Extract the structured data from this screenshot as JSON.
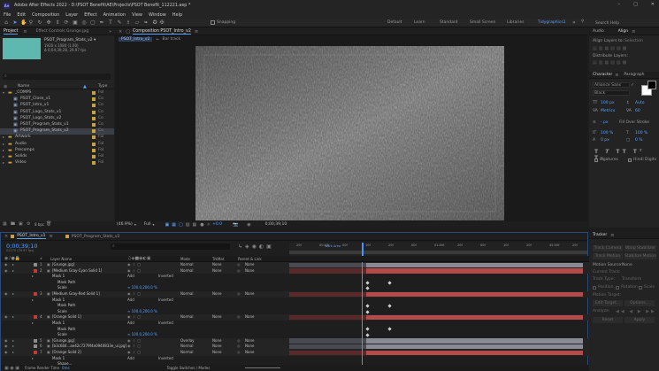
{
  "window": {
    "title": "Adobe After Effects 2022 - D:\\PSOT Benefit\\AE\\Projects\\PSOT Benefit_112221.aep *"
  },
  "menu": [
    "File",
    "Edit",
    "Composition",
    "Layer",
    "Effect",
    "Animation",
    "View",
    "Window",
    "Help"
  ],
  "toolbar": {
    "snapping": "Snapping",
    "workspaces": [
      "Default",
      "Learn",
      "Standard",
      "Small Screen",
      "Libraries",
      "Tidygraphics1"
    ],
    "search_placeholder": "Search Help"
  },
  "project": {
    "tab": "Project",
    "effect_tab": "Effect Controls Grunge.jpg",
    "selected_name": "PSOT_Program_Stats_v2 ▾",
    "selected_info1": "1920 x 1080 (1.00)",
    "selected_info2": "Δ 0;04;39;28, 29.97 fps",
    "search_placeholder": "⌕",
    "col_name": "Name",
    "col_type": "Type",
    "items": [
      {
        "name": "_COMPS",
        "type": "Fol",
        "color": "#c8a23c",
        "indent": 0,
        "open": true
      },
      {
        "name": "PSOT_Close_v1",
        "type": "Co",
        "color": "#c8a23c",
        "indent": 1
      },
      {
        "name": "PSOT_Intro_v1",
        "type": "Co",
        "color": "#c8a23c",
        "indent": 1
      },
      {
        "name": "PSOT_Logo_Stats_v1",
        "type": "Co",
        "color": "#c8a23c",
        "indent": 1
      },
      {
        "name": "PSOT_Logo_Stats_v2",
        "type": "Co",
        "color": "#c8a23c",
        "indent": 1
      },
      {
        "name": "PSOT_Program_Stats_v1",
        "type": "Co",
        "color": "#c8a23c",
        "indent": 1
      },
      {
        "name": "PSOT_Program_Stats_v2",
        "type": "Co",
        "color": "#c8a23c",
        "indent": 1,
        "selected": true
      },
      {
        "name": "Artwork",
        "type": "Fol",
        "color": "#c8a23c",
        "indent": 0
      },
      {
        "name": "Audio",
        "type": "Fol",
        "color": "#c8a23c",
        "indent": 0
      },
      {
        "name": "Precomps",
        "type": "Fol",
        "color": "#c8a23c",
        "indent": 0
      },
      {
        "name": "Solids",
        "type": "Fol",
        "color": "#c8a23c",
        "indent": 0
      },
      {
        "name": "Video",
        "type": "Fol",
        "color": "#c8a23c",
        "indent": 0
      }
    ],
    "bpc": "8 bpc"
  },
  "composition": {
    "tab": "Composition PSOT_Intro_v2",
    "subtab": "PSOT_Intro_v2",
    "flowchart": "Bar track",
    "zoom": "(46.9%)",
    "quality": "Full",
    "exposure": "+0.0",
    "timecode": "0;00;39;10"
  },
  "right": {
    "audio": "Audio",
    "align": "Align",
    "align_to_label": "Align Layers to:",
    "align_to": "Selection",
    "distribute": "Distribute Layers:",
    "character": "Character",
    "paragraph": "Paragraph",
    "font": "Alliance Sans",
    "style": "Black",
    "font_size": "100 px",
    "tracking": "Auto",
    "leading_label": "Metrics",
    "leading_val": "60",
    "stroke": "- px",
    "stroke_mode": "Fill Over Stroke",
    "vscale": "100 %",
    "hscale": "100 %",
    "baseline": "0 px",
    "tsume": "0 %",
    "ligatures": "Ligatures",
    "hindi": "Hindi Digits",
    "tracker": "Tracker",
    "tracker_buttons": [
      "Track Camera",
      "Warp Stabilizer",
      "Track Motion",
      "Stabilize Motion"
    ],
    "motion_source": "Motion Source:",
    "motion_source_val": "None",
    "current_track": "Current Track:",
    "track_type": "Track Type:",
    "track_type_val": "Transform",
    "track_opts": [
      "Position",
      "Rotation",
      "Scale"
    ],
    "motion_target": "Motion Target:",
    "edit_target": "Edit Target...",
    "options": "Options...",
    "analyze": "Analyze:",
    "reset": "Reset",
    "apply": "Apply"
  },
  "timeline": {
    "tabs": [
      "PSOT_Intro_v1",
      "PSOT_Program_Stats_v2"
    ],
    "timecode": "0;00;39;10",
    "frame_info": "01170 (29.97 fps)",
    "search_placeholder": "⌕",
    "col_layer": "Layer Name",
    "col_mode": "Mode",
    "col_trkmat": "TrkMat",
    "col_parent": "Parent & Link",
    "ruler": [
      "20f",
      "00:15f",
      "00f",
      "10f",
      "20f",
      "00f",
      "01:00f",
      "20f",
      "00f",
      "10f",
      "20f",
      "45:00f",
      "20f"
    ],
    "ruler_label": "Work Area",
    "footer_render": "Frame Render Time",
    "footer_ms": "0ms",
    "footer_toggle": "Toggle Switches / Modes",
    "layers": [
      {
        "num": "1",
        "name": "[Grunge.jpg]",
        "mode": "Normal",
        "trk": "None",
        "parent": "None",
        "color": "#8c8c8c",
        "bar": "#8a8a94"
      },
      {
        "num": "2",
        "name": "[Medium Gray-Cyan Solid 1]",
        "mode": "Normal",
        "trk": "None",
        "parent": "None",
        "color": "#c23b3b",
        "bar": "#b54a4a"
      },
      {
        "num": "",
        "name": "Mask 1",
        "mode": "Add",
        "trk": "Inverted",
        "parent": "",
        "color": "",
        "sub": 1
      },
      {
        "num": "",
        "name": "Mask Path",
        "mode": "",
        "trk": "",
        "parent": "",
        "color": "",
        "sub": 2
      },
      {
        "num": "",
        "name": "Scale",
        "mode": "",
        "trk": "",
        "parent": "",
        "color": "",
        "sub": 2,
        "value": "∞ 100.0,200.0 %"
      },
      {
        "num": "3",
        "name": "[Medium Gray-Red Solid 1]",
        "mode": "Normal",
        "trk": "None",
        "parent": "None",
        "color": "#c23b3b",
        "bar": "#b54a4a"
      },
      {
        "num": "",
        "name": "Mask 1",
        "mode": "Add",
        "trk": "Inverted",
        "parent": "",
        "color": "",
        "sub": 1
      },
      {
        "num": "",
        "name": "Mask Path",
        "mode": "",
        "trk": "",
        "parent": "",
        "color": "",
        "sub": 2
      },
      {
        "num": "",
        "name": "Scale",
        "mode": "",
        "trk": "",
        "parent": "",
        "color": "",
        "sub": 2,
        "value": "∞ 100.0,200.0 %"
      },
      {
        "num": "4",
        "name": "[Orange Solid 1]",
        "mode": "Normal",
        "trk": "None",
        "parent": "None",
        "color": "#c23b3b",
        "bar": "#b54a4a"
      },
      {
        "num": "",
        "name": "Mask 1",
        "mode": "Add",
        "trk": "Inverted",
        "parent": "",
        "color": "",
        "sub": 1
      },
      {
        "num": "",
        "name": "Mask Path",
        "mode": "",
        "trk": "",
        "parent": "",
        "color": "",
        "sub": 2
      },
      {
        "num": "",
        "name": "Scale",
        "mode": "",
        "trk": "",
        "parent": "",
        "color": "",
        "sub": 2,
        "value": "∞ 100.0,200.0 %"
      },
      {
        "num": "5",
        "name": "[Grunge.jpg]",
        "mode": "Overlay",
        "trk": "None",
        "parent": "None",
        "color": "#8c8c8c",
        "bar": "#8a8a94"
      },
      {
        "num": "6",
        "name": "[b3c684...ae42c7279f4e0940833e_ui.jpg]",
        "mode": "Normal",
        "trk": "None",
        "parent": "None",
        "color": "#8c8c8c",
        "bar": "#8a8a94"
      },
      {
        "num": "7",
        "name": "[Orange Solid 2]",
        "mode": "Normal",
        "trk": "None",
        "parent": "None",
        "color": "#c23b3b",
        "bar": "#b54a4a"
      },
      {
        "num": "",
        "name": "Mask 1",
        "mode": "Add",
        "trk": "Inverted",
        "parent": "",
        "color": "",
        "sub": 1
      },
      {
        "num": "",
        "name": "Shape...",
        "mode": "",
        "trk": "",
        "parent": "",
        "color": "",
        "sub": 2
      }
    ]
  }
}
